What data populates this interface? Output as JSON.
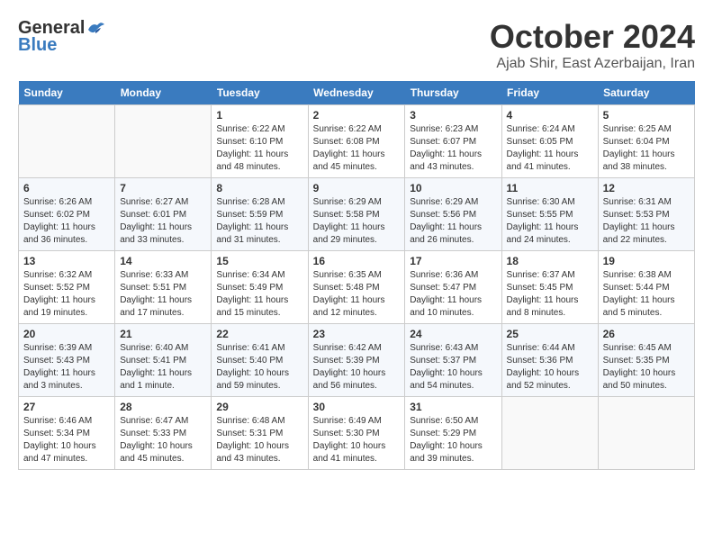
{
  "header": {
    "logo_general": "General",
    "logo_blue": "Blue",
    "month": "October 2024",
    "location": "Ajab Shir, East Azerbaijan, Iran"
  },
  "columns": [
    "Sunday",
    "Monday",
    "Tuesday",
    "Wednesday",
    "Thursday",
    "Friday",
    "Saturday"
  ],
  "weeks": [
    [
      {
        "day": "",
        "sunrise": "",
        "sunset": "",
        "daylight": ""
      },
      {
        "day": "",
        "sunrise": "",
        "sunset": "",
        "daylight": ""
      },
      {
        "day": "1",
        "sunrise": "Sunrise: 6:22 AM",
        "sunset": "Sunset: 6:10 PM",
        "daylight": "Daylight: 11 hours and 48 minutes."
      },
      {
        "day": "2",
        "sunrise": "Sunrise: 6:22 AM",
        "sunset": "Sunset: 6:08 PM",
        "daylight": "Daylight: 11 hours and 45 minutes."
      },
      {
        "day": "3",
        "sunrise": "Sunrise: 6:23 AM",
        "sunset": "Sunset: 6:07 PM",
        "daylight": "Daylight: 11 hours and 43 minutes."
      },
      {
        "day": "4",
        "sunrise": "Sunrise: 6:24 AM",
        "sunset": "Sunset: 6:05 PM",
        "daylight": "Daylight: 11 hours and 41 minutes."
      },
      {
        "day": "5",
        "sunrise": "Sunrise: 6:25 AM",
        "sunset": "Sunset: 6:04 PM",
        "daylight": "Daylight: 11 hours and 38 minutes."
      }
    ],
    [
      {
        "day": "6",
        "sunrise": "Sunrise: 6:26 AM",
        "sunset": "Sunset: 6:02 PM",
        "daylight": "Daylight: 11 hours and 36 minutes."
      },
      {
        "day": "7",
        "sunrise": "Sunrise: 6:27 AM",
        "sunset": "Sunset: 6:01 PM",
        "daylight": "Daylight: 11 hours and 33 minutes."
      },
      {
        "day": "8",
        "sunrise": "Sunrise: 6:28 AM",
        "sunset": "Sunset: 5:59 PM",
        "daylight": "Daylight: 11 hours and 31 minutes."
      },
      {
        "day": "9",
        "sunrise": "Sunrise: 6:29 AM",
        "sunset": "Sunset: 5:58 PM",
        "daylight": "Daylight: 11 hours and 29 minutes."
      },
      {
        "day": "10",
        "sunrise": "Sunrise: 6:29 AM",
        "sunset": "Sunset: 5:56 PM",
        "daylight": "Daylight: 11 hours and 26 minutes."
      },
      {
        "day": "11",
        "sunrise": "Sunrise: 6:30 AM",
        "sunset": "Sunset: 5:55 PM",
        "daylight": "Daylight: 11 hours and 24 minutes."
      },
      {
        "day": "12",
        "sunrise": "Sunrise: 6:31 AM",
        "sunset": "Sunset: 5:53 PM",
        "daylight": "Daylight: 11 hours and 22 minutes."
      }
    ],
    [
      {
        "day": "13",
        "sunrise": "Sunrise: 6:32 AM",
        "sunset": "Sunset: 5:52 PM",
        "daylight": "Daylight: 11 hours and 19 minutes."
      },
      {
        "day": "14",
        "sunrise": "Sunrise: 6:33 AM",
        "sunset": "Sunset: 5:51 PM",
        "daylight": "Daylight: 11 hours and 17 minutes."
      },
      {
        "day": "15",
        "sunrise": "Sunrise: 6:34 AM",
        "sunset": "Sunset: 5:49 PM",
        "daylight": "Daylight: 11 hours and 15 minutes."
      },
      {
        "day": "16",
        "sunrise": "Sunrise: 6:35 AM",
        "sunset": "Sunset: 5:48 PM",
        "daylight": "Daylight: 11 hours and 12 minutes."
      },
      {
        "day": "17",
        "sunrise": "Sunrise: 6:36 AM",
        "sunset": "Sunset: 5:47 PM",
        "daylight": "Daylight: 11 hours and 10 minutes."
      },
      {
        "day": "18",
        "sunrise": "Sunrise: 6:37 AM",
        "sunset": "Sunset: 5:45 PM",
        "daylight": "Daylight: 11 hours and 8 minutes."
      },
      {
        "day": "19",
        "sunrise": "Sunrise: 6:38 AM",
        "sunset": "Sunset: 5:44 PM",
        "daylight": "Daylight: 11 hours and 5 minutes."
      }
    ],
    [
      {
        "day": "20",
        "sunrise": "Sunrise: 6:39 AM",
        "sunset": "Sunset: 5:43 PM",
        "daylight": "Daylight: 11 hours and 3 minutes."
      },
      {
        "day": "21",
        "sunrise": "Sunrise: 6:40 AM",
        "sunset": "Sunset: 5:41 PM",
        "daylight": "Daylight: 11 hours and 1 minute."
      },
      {
        "day": "22",
        "sunrise": "Sunrise: 6:41 AM",
        "sunset": "Sunset: 5:40 PM",
        "daylight": "Daylight: 10 hours and 59 minutes."
      },
      {
        "day": "23",
        "sunrise": "Sunrise: 6:42 AM",
        "sunset": "Sunset: 5:39 PM",
        "daylight": "Daylight: 10 hours and 56 minutes."
      },
      {
        "day": "24",
        "sunrise": "Sunrise: 6:43 AM",
        "sunset": "Sunset: 5:37 PM",
        "daylight": "Daylight: 10 hours and 54 minutes."
      },
      {
        "day": "25",
        "sunrise": "Sunrise: 6:44 AM",
        "sunset": "Sunset: 5:36 PM",
        "daylight": "Daylight: 10 hours and 52 minutes."
      },
      {
        "day": "26",
        "sunrise": "Sunrise: 6:45 AM",
        "sunset": "Sunset: 5:35 PM",
        "daylight": "Daylight: 10 hours and 50 minutes."
      }
    ],
    [
      {
        "day": "27",
        "sunrise": "Sunrise: 6:46 AM",
        "sunset": "Sunset: 5:34 PM",
        "daylight": "Daylight: 10 hours and 47 minutes."
      },
      {
        "day": "28",
        "sunrise": "Sunrise: 6:47 AM",
        "sunset": "Sunset: 5:33 PM",
        "daylight": "Daylight: 10 hours and 45 minutes."
      },
      {
        "day": "29",
        "sunrise": "Sunrise: 6:48 AM",
        "sunset": "Sunset: 5:31 PM",
        "daylight": "Daylight: 10 hours and 43 minutes."
      },
      {
        "day": "30",
        "sunrise": "Sunrise: 6:49 AM",
        "sunset": "Sunset: 5:30 PM",
        "daylight": "Daylight: 10 hours and 41 minutes."
      },
      {
        "day": "31",
        "sunrise": "Sunrise: 6:50 AM",
        "sunset": "Sunset: 5:29 PM",
        "daylight": "Daylight: 10 hours and 39 minutes."
      },
      {
        "day": "",
        "sunrise": "",
        "sunset": "",
        "daylight": ""
      },
      {
        "day": "",
        "sunrise": "",
        "sunset": "",
        "daylight": ""
      }
    ]
  ]
}
